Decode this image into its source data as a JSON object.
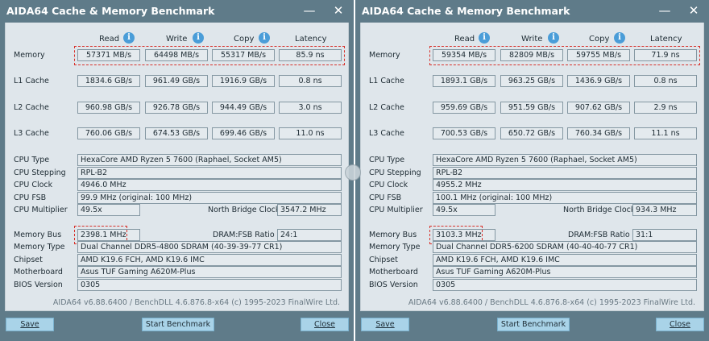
{
  "windows": [
    {
      "title": "AIDA64 Cache & Memory Benchmark",
      "headers": {
        "read": "Read",
        "write": "Write",
        "copy": "Copy",
        "latency": "Latency"
      },
      "rows": [
        {
          "label": "Memory",
          "read": "57371 MB/s",
          "write": "64498 MB/s",
          "copy": "55317 MB/s",
          "latency": "85.9 ns"
        },
        {
          "label": "L1 Cache",
          "read": "1834.6 GB/s",
          "write": "961.49 GB/s",
          "copy": "1916.9 GB/s",
          "latency": "0.8 ns"
        },
        {
          "label": "L2 Cache",
          "read": "960.98 GB/s",
          "write": "926.78 GB/s",
          "copy": "944.49 GB/s",
          "latency": "3.0 ns"
        },
        {
          "label": "L3 Cache",
          "read": "760.06 GB/s",
          "write": "674.53 GB/s",
          "copy": "699.46 GB/s",
          "latency": "11.0 ns"
        }
      ],
      "cpu": {
        "type_label": "CPU Type",
        "type": "HexaCore AMD Ryzen 5 7600  (Raphael, Socket AM5)",
        "stepping_label": "CPU Stepping",
        "stepping": "RPL-B2",
        "clock_label": "CPU Clock",
        "clock": "4946.0 MHz",
        "fsb_label": "CPU FSB",
        "fsb": "99.9 MHz  (original: 100 MHz)",
        "multiplier_label": "CPU Multiplier",
        "multiplier": "49.5x",
        "nb_clock_label": "North Bridge Clock",
        "nb_clock": "3547.2 MHz"
      },
      "mem": {
        "bus_label": "Memory Bus",
        "bus": "2398.1 MHz",
        "ratio_label": "DRAM:FSB Ratio",
        "ratio": "24:1",
        "type_label": "Memory Type",
        "type": "Dual Channel DDR5-4800 SDRAM  (40-39-39-77 CR1)",
        "chipset_label": "Chipset",
        "chipset": "AMD K19.6 FCH, AMD K19.6 IMC",
        "mobo_label": "Motherboard",
        "mobo": "Asus TUF Gaming A620M-Plus",
        "bios_label": "BIOS Version",
        "bios": "0305"
      },
      "footer": "AIDA64 v6.88.6400 / BenchDLL 4.6.876.8-x64  (c) 1995-2023 FinalWire Ltd.",
      "buttons": {
        "save": "Save",
        "start": "Start Benchmark",
        "close": "Close"
      }
    },
    {
      "title": "AIDA64 Cache & Memory Benchmark",
      "headers": {
        "read": "Read",
        "write": "Write",
        "copy": "Copy",
        "latency": "Latency"
      },
      "rows": [
        {
          "label": "Memory",
          "read": "59354 MB/s",
          "write": "82809 MB/s",
          "copy": "59755 MB/s",
          "latency": "71.9 ns"
        },
        {
          "label": "L1 Cache",
          "read": "1893.1 GB/s",
          "write": "963.25 GB/s",
          "copy": "1436.9 GB/s",
          "latency": "0.8 ns"
        },
        {
          "label": "L2 Cache",
          "read": "959.69 GB/s",
          "write": "951.59 GB/s",
          "copy": "907.62 GB/s",
          "latency": "2.9 ns"
        },
        {
          "label": "L3 Cache",
          "read": "700.53 GB/s",
          "write": "650.72 GB/s",
          "copy": "760.34 GB/s",
          "latency": "11.1 ns"
        }
      ],
      "cpu": {
        "type_label": "CPU Type",
        "type": "HexaCore AMD Ryzen 5 7600  (Raphael, Socket AM5)",
        "stepping_label": "CPU Stepping",
        "stepping": "RPL-B2",
        "clock_label": "CPU Clock",
        "clock": "4955.2 MHz",
        "fsb_label": "CPU FSB",
        "fsb": "100.1 MHz  (original: 100 MHz)",
        "multiplier_label": "CPU Multiplier",
        "multiplier": "49.5x",
        "nb_clock_label": "North Bridge Clock",
        "nb_clock": "934.3 MHz"
      },
      "mem": {
        "bus_label": "Memory Bus",
        "bus": "3103.3 MHz",
        "ratio_label": "DRAM:FSB Ratio",
        "ratio": "31:1",
        "type_label": "Memory Type",
        "type": "Dual Channel DDR5-6200 SDRAM  (40-40-40-77 CR1)",
        "chipset_label": "Chipset",
        "chipset": "AMD K19.6 FCH, AMD K19.6 IMC",
        "mobo_label": "Motherboard",
        "mobo": "Asus TUF Gaming A620M-Plus",
        "bios_label": "BIOS Version",
        "bios": "0305"
      },
      "footer": "AIDA64 v6.88.6400 / BenchDLL 4.6.876.8-x64  (c) 1995-2023 FinalWire Ltd.",
      "buttons": {
        "save": "Save",
        "start": "Start Benchmark",
        "close": "Close"
      }
    }
  ],
  "icons": {
    "info": "info-icon",
    "minimize": "minimize-icon",
    "close": "close-icon"
  },
  "colors": {
    "frame": "#5f7b89",
    "panel": "#dfe6eb",
    "button": "#a9d3e8",
    "highlight": "#d8302a",
    "info": "#4a9dd8"
  }
}
